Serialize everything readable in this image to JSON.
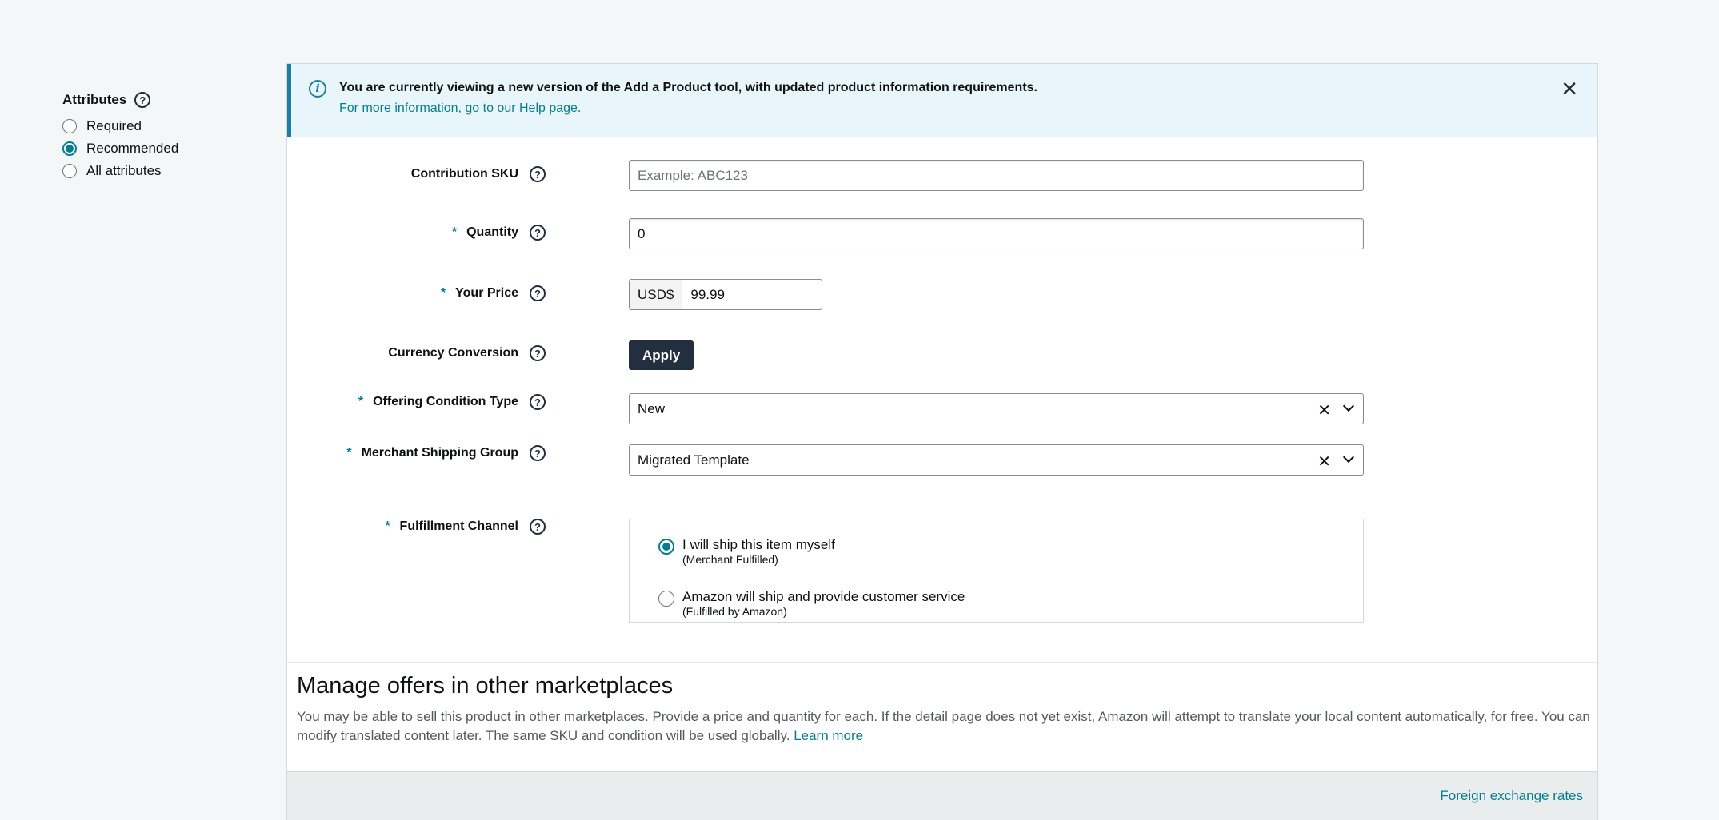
{
  "sidebar": {
    "title": "Attributes",
    "options": [
      {
        "label": "Required",
        "checked": false
      },
      {
        "label": "Recommended",
        "checked": true
      },
      {
        "label": "All attributes",
        "checked": false
      }
    ]
  },
  "banner": {
    "message": "You are currently viewing a new version of the Add a Product tool, with updated product information requirements.",
    "link": "For more information, go to our Help page."
  },
  "form": {
    "contribution_sku": {
      "label": "Contribution SKU",
      "placeholder": "Example: ABC123",
      "value": ""
    },
    "quantity": {
      "label": "Quantity",
      "value": "0",
      "required": "*"
    },
    "price": {
      "label": "Your Price",
      "currency": "USD$",
      "value": "99.99",
      "required": "*"
    },
    "currency_conversion": {
      "label": "Currency Conversion",
      "button": "Apply"
    },
    "condition": {
      "label": "Offering Condition Type",
      "value": "New",
      "required": "*"
    },
    "shipping_group": {
      "label": "Merchant Shipping Group",
      "value": "Migrated Template",
      "required": "*"
    },
    "fulfillment": {
      "label": "Fulfillment Channel",
      "required": "*",
      "options": [
        {
          "title": "I will ship this item myself",
          "subtitle": "(Merchant Fulfilled)",
          "checked": true
        },
        {
          "title": "Amazon will ship and provide customer service",
          "subtitle": "(Fulfilled by Amazon)",
          "checked": false
        }
      ]
    }
  },
  "manage": {
    "title": "Manage offers in other marketplaces",
    "description": "You may be able to sell this product in other marketplaces. Provide a price and quantity for each. If the detail page does not yet exist, Amazon will attempt to translate your local content automatically, for free. You can modify translated content later. The same SKU and condition will be used globally.",
    "learn_more": "Learn more"
  },
  "footer": {
    "fx_link": "Foreign exchange rates"
  },
  "icons": {
    "help": "question-circle-icon",
    "info": "info-icon",
    "close": "close-icon",
    "clear": "clear-x-icon",
    "chevron": "chevron-down-icon"
  },
  "colors": {
    "accent": "#067d8e",
    "banner_bg": "#e8f6fb",
    "button_dark": "#232f3e"
  }
}
